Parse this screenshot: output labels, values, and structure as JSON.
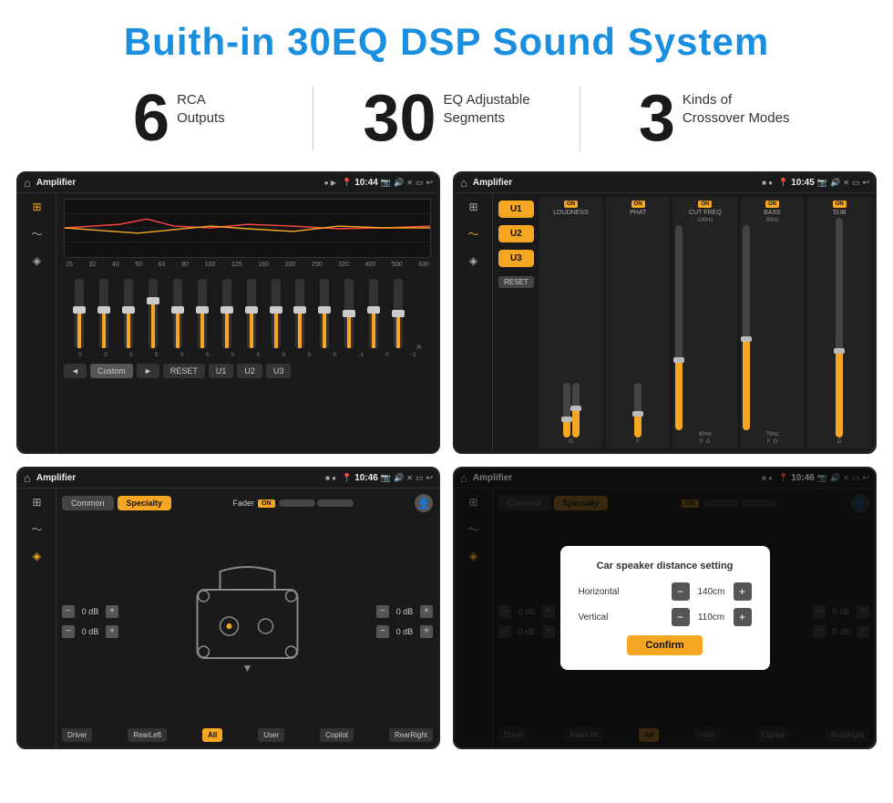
{
  "header": {
    "title": "Buith-in 30EQ DSP Sound System"
  },
  "stats": [
    {
      "number": "6",
      "label": "RCA\nOutputs"
    },
    {
      "number": "30",
      "label": "EQ Adjustable\nSegments"
    },
    {
      "number": "3",
      "label": "Kinds of\nCrossover Modes"
    }
  ],
  "screens": [
    {
      "id": "screen-eq",
      "status_bar": {
        "app": "Amplifier",
        "time": "10:44"
      },
      "type": "eq"
    },
    {
      "id": "screen-crossover",
      "status_bar": {
        "app": "Amplifier",
        "time": "10:45"
      },
      "type": "crossover"
    },
    {
      "id": "screen-fader",
      "status_bar": {
        "app": "Amplifier",
        "time": "10:46"
      },
      "type": "fader"
    },
    {
      "id": "screen-distance",
      "status_bar": {
        "app": "Amplifier",
        "time": "10:46"
      },
      "type": "distance"
    }
  ],
  "eq_screen": {
    "freq_labels": [
      "25",
      "32",
      "40",
      "50",
      "63",
      "80",
      "100",
      "125",
      "160",
      "200",
      "250",
      "320",
      "400",
      "500",
      "630"
    ],
    "slider_values": [
      "0",
      "0",
      "0",
      "5",
      "0",
      "0",
      "0",
      "0",
      "0",
      "0",
      "0",
      "-1",
      "0",
      "-1"
    ],
    "bottom_buttons": [
      "◄",
      "Custom",
      "►",
      "RESET",
      "U1",
      "U2",
      "U3"
    ]
  },
  "crossover_screen": {
    "u_buttons": [
      "U1",
      "U2",
      "U3"
    ],
    "controls": [
      {
        "label": "LOUDNESS",
        "on": true
      },
      {
        "label": "PHAT",
        "on": true
      },
      {
        "label": "CUT FREQ",
        "on": true
      },
      {
        "label": "BASS",
        "on": true
      },
      {
        "label": "SUB",
        "on": true
      }
    ],
    "reset_label": "RESET"
  },
  "fader_screen": {
    "tabs": [
      "Common",
      "Specialty"
    ],
    "fader_label": "Fader",
    "fader_on": "ON",
    "vol_controls": [
      {
        "value": "0 dB"
      },
      {
        "value": "0 dB"
      },
      {
        "value": "0 dB"
      },
      {
        "value": "0 dB"
      }
    ],
    "bottom_buttons": [
      "Driver",
      "RearLeft",
      "All",
      "User",
      "Copilot",
      "RearRight"
    ]
  },
  "distance_screen": {
    "tabs": [
      "Common",
      "Specialty"
    ],
    "dialog": {
      "title": "Car speaker distance setting",
      "horizontal_label": "Horizontal",
      "horizontal_value": "140cm",
      "vertical_label": "Vertical",
      "vertical_value": "110cm",
      "confirm_label": "Confirm"
    },
    "vol_controls": [
      {
        "value": "0 dB"
      },
      {
        "value": "0 dB"
      }
    ]
  }
}
